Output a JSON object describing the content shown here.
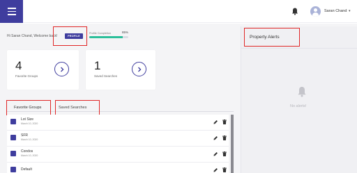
{
  "header": {
    "user_name": "Saran Chand",
    "user_caret": "▾",
    "icons": [
      "menu-icon",
      "bell-icon",
      "avatar-icon",
      "chevron-down-icon"
    ]
  },
  "welcome": {
    "text": "Hi Saran Chand, Welcome back!",
    "profile_button": "PROFILE",
    "profile_completion_label": "Profile Completion",
    "profile_completion_value": "85%",
    "profile_completion_fraction": 0.85
  },
  "cards": {
    "favorite_groups": {
      "count": "4",
      "label": "Favorite Groups",
      "icon": "chevron-right-icon"
    },
    "saved_searches": {
      "count": "1",
      "label": "Saved Searches",
      "icon": "chevron-right-icon"
    }
  },
  "tabs": {
    "favorite_groups": "Favorite Groups",
    "saved_searches": "Saved Searches"
  },
  "groups": [
    {
      "name": "Lot Size",
      "date": "March 10, 2020"
    },
    {
      "name": "SFR",
      "date": "March 10, 2020"
    },
    {
      "name": "Condos",
      "date": "March 10, 2020"
    },
    {
      "name": "Default",
      "date": ""
    }
  ],
  "alerts": {
    "title": "Property Alerts",
    "empty_text": "No alerts!"
  },
  "colors": {
    "primary": "#3f3d9e",
    "progress": "#2bbf9a",
    "highlight": "#e02626"
  }
}
